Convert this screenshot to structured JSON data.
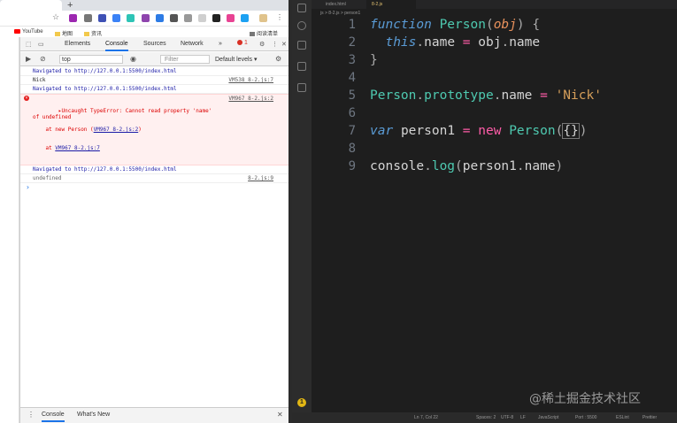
{
  "browser": {
    "new_tab_symbol": "+",
    "bookmarks": [
      {
        "label": "YouTube",
        "icon": "youtube-icon"
      },
      {
        "label": "地图",
        "icon": "folder-icon"
      },
      {
        "label": "资讯",
        "icon": "folder-icon"
      }
    ],
    "reading_list": "阅读清单"
  },
  "devtools": {
    "tabs": [
      "Elements",
      "Console",
      "Sources",
      "Network"
    ],
    "active_tab": "Console",
    "more_tabs": "»",
    "error_count": "1",
    "context": "top",
    "filter_placeholder": "Filter",
    "levels": "Default levels ▾",
    "console_lines": [
      {
        "type": "nav",
        "text": "Navigated to http://127.0.0.1:5500/index.html"
      },
      {
        "type": "log",
        "text": "Nick",
        "source": "VM538 8-2.js:7"
      },
      {
        "type": "nav",
        "text": "Navigated to http://127.0.0.1:5500/index.html"
      },
      {
        "type": "error",
        "text": "▸Uncaught TypeError: Cannot read property 'name'\nof undefined",
        "source": "VM967 8-2.js:2",
        "stack": [
          "at new Person (",
          "VM967 8-2.js:2",
          ")",
          "at ",
          "VM967 8-2.js:7"
        ]
      },
      {
        "type": "nav",
        "text": "Navigated to http://127.0.0.1:5500/index.html"
      },
      {
        "type": "log",
        "text": "undefined",
        "source": "8-2.js:9"
      }
    ],
    "prompt": "›",
    "drawer_tabs": [
      "Console",
      "What's New"
    ]
  },
  "vscode": {
    "tabs": [
      "index.html",
      "8-2.js"
    ],
    "active_tab": "8-2.js",
    "breadcrumb": "js > 8-2.js > person1",
    "lines": [
      {
        "n": "1",
        "tokens": [
          [
            "kw",
            "function"
          ],
          [
            "sp",
            " "
          ],
          [
            "fn",
            "Person"
          ],
          [
            "punct",
            "("
          ],
          [
            "param",
            "obj"
          ],
          [
            "punct",
            ")"
          ],
          [
            "sp",
            " "
          ],
          [
            "punct",
            "{"
          ]
        ]
      },
      {
        "n": "2",
        "tokens": [
          [
            "sp",
            "  "
          ],
          [
            "this",
            "this"
          ],
          [
            "punct",
            "."
          ],
          [
            "prop",
            "name"
          ],
          [
            "sp",
            " "
          ],
          [
            "op",
            "="
          ],
          [
            "sp",
            " "
          ],
          [
            "var",
            "obj"
          ],
          [
            "punct",
            "."
          ],
          [
            "prop",
            "name"
          ]
        ]
      },
      {
        "n": "3",
        "tokens": [
          [
            "punct",
            "}"
          ]
        ]
      },
      {
        "n": "4",
        "tokens": []
      },
      {
        "n": "5",
        "tokens": [
          [
            "cls",
            "Person"
          ],
          [
            "punct",
            "."
          ],
          [
            "cls",
            "prototype"
          ],
          [
            "punct",
            "."
          ],
          [
            "prop",
            "name"
          ],
          [
            "sp",
            " "
          ],
          [
            "op",
            "="
          ],
          [
            "sp",
            " "
          ],
          [
            "str",
            "'Nick'"
          ]
        ]
      },
      {
        "n": "6",
        "tokens": []
      },
      {
        "n": "7",
        "tokens": [
          [
            "kw",
            "var"
          ],
          [
            "sp",
            " "
          ],
          [
            "var",
            "person1"
          ],
          [
            "sp",
            " "
          ],
          [
            "op",
            "="
          ],
          [
            "sp",
            " "
          ],
          [
            "newkw",
            "new"
          ],
          [
            "sp",
            " "
          ],
          [
            "cls",
            "Person"
          ],
          [
            "punct",
            "("
          ],
          [
            "brk",
            "{}"
          ],
          [
            "cursor",
            ""
          ],
          [
            "punct",
            ")"
          ]
        ]
      },
      {
        "n": "8",
        "tokens": []
      },
      {
        "n": "9",
        "tokens": [
          [
            "var",
            "console"
          ],
          [
            "punct",
            "."
          ],
          [
            "fn",
            "log"
          ],
          [
            "punct",
            "("
          ],
          [
            "var",
            "person1"
          ],
          [
            "punct",
            "."
          ],
          [
            "prop",
            "name"
          ],
          [
            "punct",
            ")"
          ]
        ]
      }
    ],
    "status_items": [
      "Ln 7, Col 22",
      "Spaces: 2",
      "UTF-8",
      "LF",
      "JavaScript",
      "Port : 5500",
      "ESLint",
      "Prettier"
    ],
    "notification_badge": "1"
  },
  "watermark": "@稀土掘金技术社区",
  "colors": {
    "accent": "#1a73e8",
    "error": "#d93025",
    "editor_bg": "#1e1e1e"
  }
}
